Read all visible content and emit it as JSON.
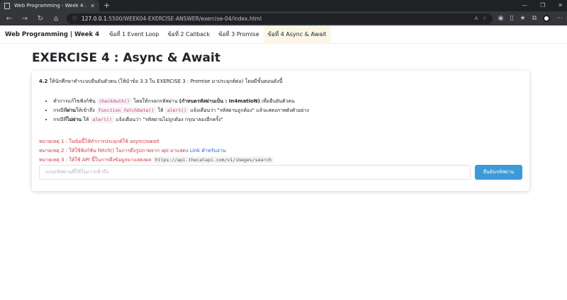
{
  "browser": {
    "tab_title": "Web Programming - Week 4 : Ex",
    "url_host": "127.0.0.1",
    "url_path": ":5500/WEEK04-EXERCISE-ANSWER/exercise-04/index.html"
  },
  "nav": {
    "brand": "Web Programming | Week 4",
    "links": [
      "ข้อที่ 1 Event Loop",
      "ข้อที่ 2 Callback",
      "ข้อที่ 3 Promise",
      "ข้อที่ 4 Async & Await"
    ]
  },
  "page": {
    "title": "EXERCISE 4 : Async & Await",
    "intro_num": "4.2",
    "intro_text": " ให้นักศึกษาทำระบบยืนยันตัวตน (ให้นำข้อ 3.3 ใน EXERCISE 3 : Promise มาประยุกต์ต่อ) โดยมีขั้นตอนดังนี้",
    "bullets": [
      {
        "pre": "ทำการแก้ไขฟังก์ชัน ",
        "code": "checkAuth()",
        "post": " โดยให้กรอกรหัสผ่าน ",
        "bold": "(กำหนดรหัสผ่านเป็น : In4matioN)",
        "tail": " เพื่อยืนยันตัวตน"
      },
      {
        "pre": "กรณีที่",
        "bold": "ผ่าน",
        "mid": "ให้เข้าถึง ",
        "code": "Function fetchData()",
        "mid2": " ให้ ",
        "code2": "alert()",
        "tail": " แจ้งเตือนว่า \"รหัสผ่านถูกต้อง\" แล้วแสดงภาพดังตัวอย่าง"
      },
      {
        "pre": "กรณีที่",
        "bold": "ไม่ผ่าน",
        "mid": " ให้ ",
        "code": "alert()",
        "tail": " แจ้งเตือนว่า \"รหัสผ่านไม่ถูกต้อง กรุณาลองอีกครั้ง\""
      }
    ],
    "notes": [
      {
        "text": "หมายเหตุ 1 : ในข้อนี้ให้ทำการประยุกต์ใช้ async/await"
      },
      {
        "text": "หมายเหตุ 2 : ให้ใช้ฟังก์ชัน fetch() ในการดึงรูปภาพจาก api มาแสดง ",
        "link": "Link คำหรับอ่าน"
      },
      {
        "text": "หมายเหตุ 3 : ให้ใช้ API นี้ในการดึงข้อมูลมาแสดงผล ",
        "url": "https://api.thecatapi.com/v1/images/search"
      }
    ],
    "input_placeholder": "ระบุรหัสผ่านที่ใช้ในการเข้าถึง",
    "submit_label": "ยืนยันรหัสผ่าน"
  }
}
